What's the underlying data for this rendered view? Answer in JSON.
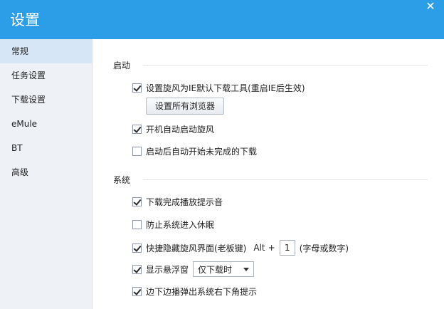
{
  "window": {
    "title": "设置"
  },
  "sidebar": {
    "items": [
      {
        "label": "常规"
      },
      {
        "label": "任务设置"
      },
      {
        "label": "下载设置"
      },
      {
        "label": "eMule"
      },
      {
        "label": "BT"
      },
      {
        "label": "高级"
      }
    ]
  },
  "startup": {
    "title": "启动",
    "ie_default": "设置旋风为IE默认下载工具(重启IE后生效)",
    "set_all_browsers": "设置所有浏览器",
    "auto_launch": "开机自动启动旋风",
    "auto_resume": "启动后自动开始未完成的下载"
  },
  "system": {
    "title": "系统",
    "play_sound": "下载完成播放提示音",
    "prevent_sleep": "防止系统进入休眠",
    "boss_key": "快捷隐藏旋风界面(老板键)",
    "alt": "Alt",
    "plus": "+",
    "key_value": "1",
    "key_hint": "(字母或数字)",
    "show_float": "显示悬浮窗",
    "float_select": "仅下载时",
    "edge_popup": "边下边播弹出系统右下角提示"
  }
}
